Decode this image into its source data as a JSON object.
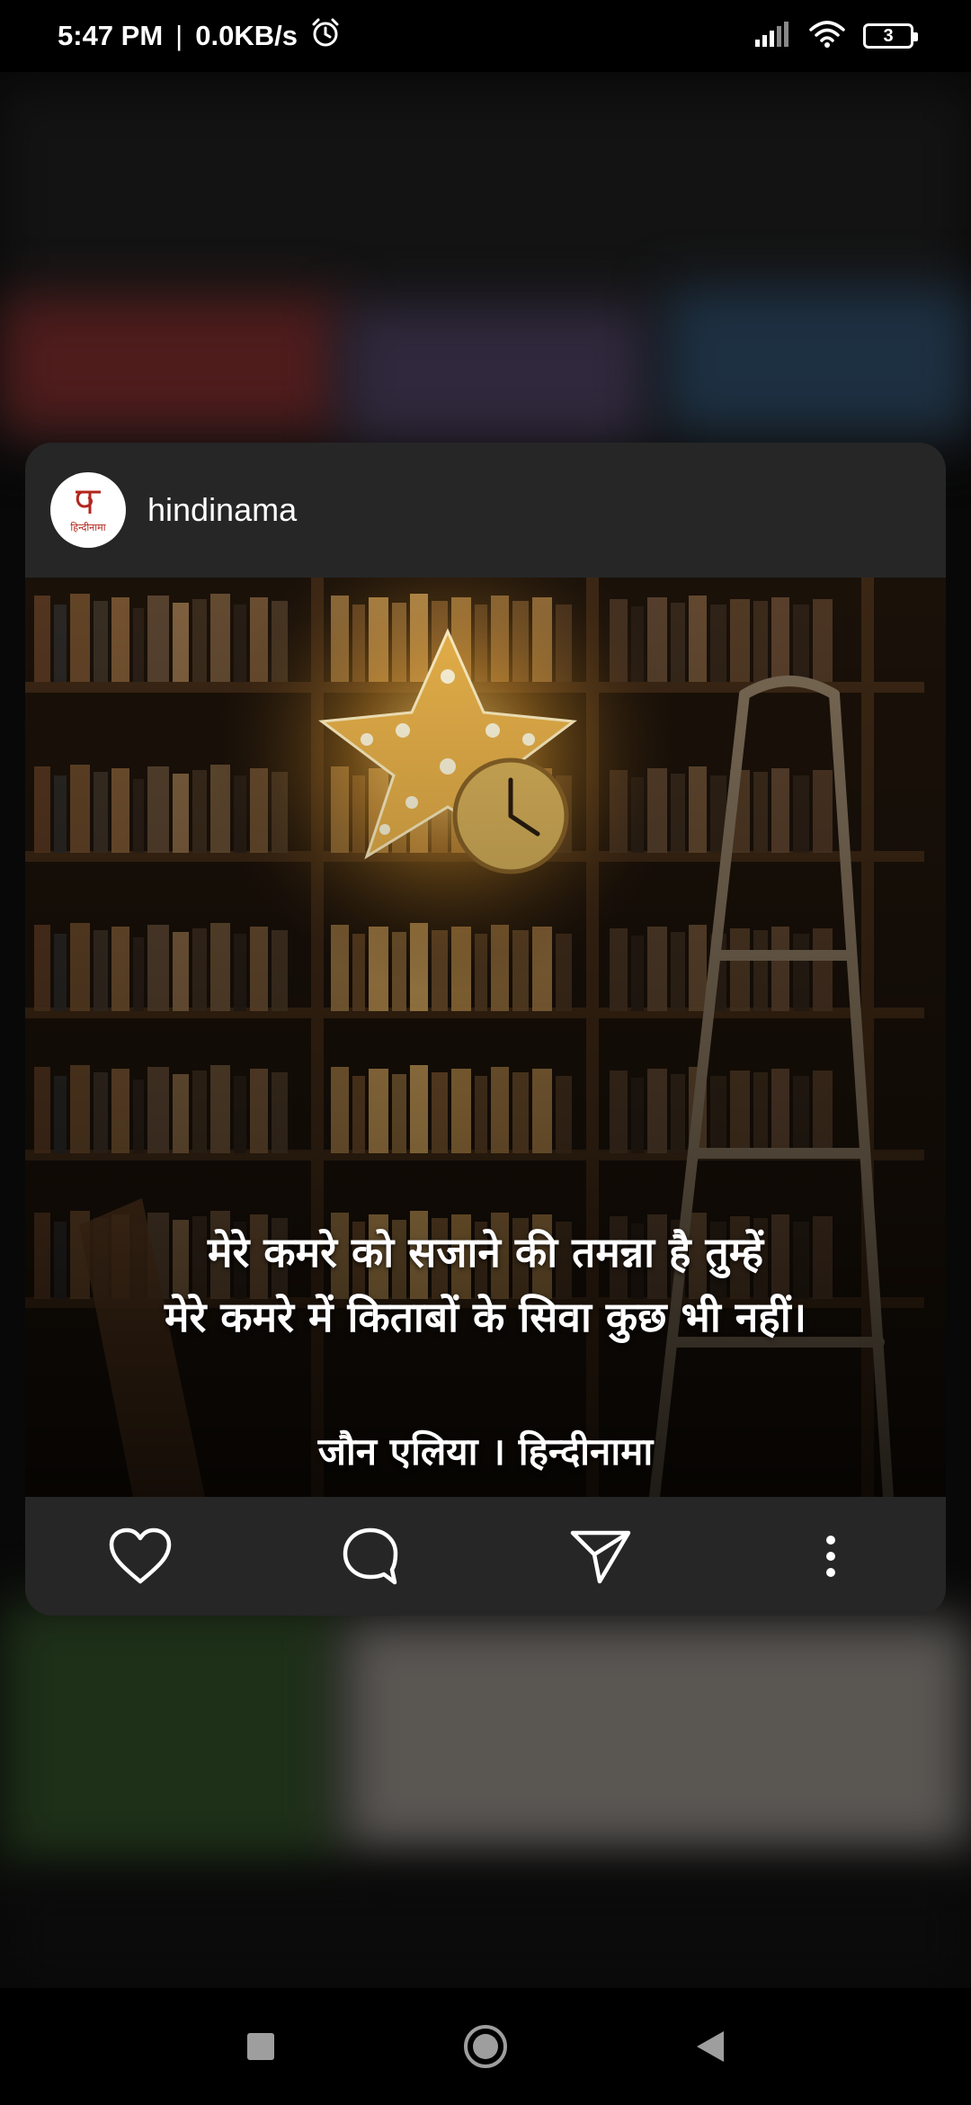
{
  "status_bar": {
    "time": "5:47 PM",
    "separator": "|",
    "network_speed": "0.0KB/s",
    "alarm_icon": "alarm-icon",
    "signal_icon": "signal-icon",
    "wifi_icon": "wifi-icon",
    "battery_level": "3"
  },
  "post": {
    "username": "hindinama",
    "avatar_text": "हिन्दीनामा",
    "image": {
      "quote_line1": "मेरे कमरे को सजाने की तमन्ना है तुम्हें",
      "quote_line2": "मेरे कमरे में किताबों के सिवा कुछ भी नहीं।",
      "credit": "जौन एलिया । हिन्दीनामा"
    },
    "actions": [
      {
        "name": "like",
        "icon": "heart-icon"
      },
      {
        "name": "comment",
        "icon": "comment-icon"
      },
      {
        "name": "share",
        "icon": "send-icon"
      },
      {
        "name": "more",
        "icon": "more-vertical-icon"
      }
    ]
  },
  "nav_bar": {
    "buttons": [
      "recents-icon",
      "home-icon",
      "back-icon"
    ]
  },
  "colors": {
    "card_bg": "#262626",
    "brand_red": "#b3261e",
    "lamp_glow": "#f5c04a"
  }
}
